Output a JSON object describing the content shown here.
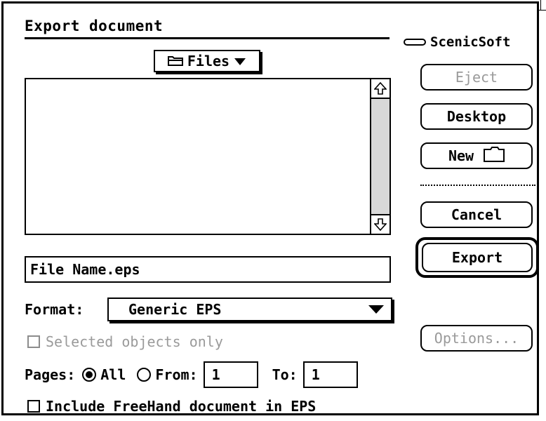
{
  "dialog": {
    "title": "Export document",
    "brand": "ScenicSoft",
    "brand_icon": "disk-icon"
  },
  "folder_popup": {
    "label": "Files",
    "icon": "folder-icon"
  },
  "file_list": {
    "items": []
  },
  "buttons": {
    "eject": "Eject",
    "desktop": "Desktop",
    "new": "New",
    "cancel": "Cancel",
    "export": "Export",
    "options": "Options..."
  },
  "filename": {
    "value": "File Name.eps"
  },
  "format": {
    "label": "Format:",
    "selected": "Generic EPS"
  },
  "selected_objects": {
    "label": "Selected objects only",
    "checked": false,
    "enabled": false
  },
  "pages": {
    "label": "Pages:",
    "all_label": "All",
    "from_label": "From:",
    "to_label": "To:",
    "from_value": "1",
    "to_value": "1",
    "selected": "All"
  },
  "include_freehand": {
    "label": "Include FreeHand document in EPS",
    "checked": false
  }
}
